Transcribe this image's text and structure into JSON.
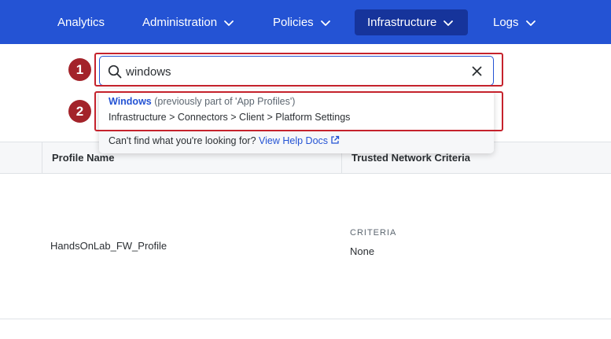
{
  "nav": {
    "items": [
      {
        "label": "Analytics",
        "has_dropdown": false,
        "active": false
      },
      {
        "label": "Administration",
        "has_dropdown": true,
        "active": false
      },
      {
        "label": "Policies",
        "has_dropdown": true,
        "active": false
      },
      {
        "label": "Infrastructure",
        "has_dropdown": true,
        "active": true
      },
      {
        "label": "Logs",
        "has_dropdown": true,
        "active": false
      }
    ]
  },
  "search": {
    "value": "windows",
    "placeholder": ""
  },
  "dropdown": {
    "result": {
      "title": "Windows",
      "note": "(previously part of 'App Profiles')",
      "path": "Infrastructure > Connectors > Client > Platform Settings"
    },
    "help_text": "Can't find what you're looking for?",
    "help_link": "View Help Docs"
  },
  "table": {
    "headers": [
      "Profile Name",
      "Trusted Network Criteria"
    ],
    "rows": [
      {
        "profile_name": "HandsOnLab_FW_Profile",
        "criteria_label": "CRITERIA",
        "criteria_value": "None"
      }
    ]
  },
  "annotations": {
    "badge_1": "1",
    "badge_2": "2"
  },
  "colors": {
    "nav_bg": "#2453d4",
    "nav_active": "#16349b",
    "link": "#2453d4",
    "annotation": "#c5222c"
  }
}
